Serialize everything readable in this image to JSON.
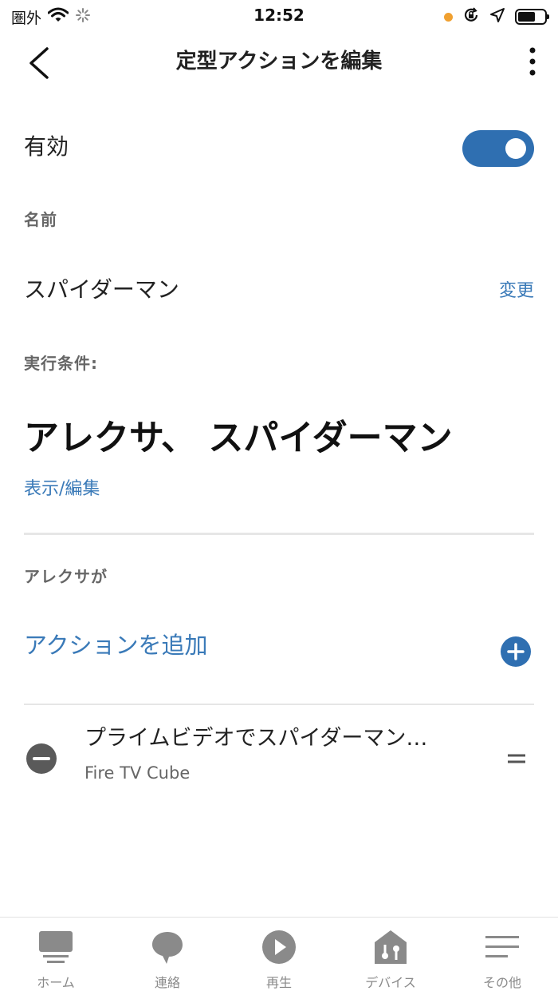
{
  "status_bar": {
    "carrier": "圏外",
    "time": "12:52",
    "battery_level": 0.65
  },
  "header": {
    "title": "定型アクションを編集",
    "back_icon": "chevron-left-icon",
    "more_icon": "more-vertical-icon"
  },
  "enabled": {
    "label": "有効",
    "value": true,
    "accent": "#2f6fb1"
  },
  "name_section": {
    "label": "名前",
    "value": "スパイダーマン",
    "change_link": "変更"
  },
  "trigger_section": {
    "label": "実行条件:",
    "phrase": "アレクサ、 スパイダーマン",
    "view_edit_link": "表示/編集"
  },
  "alexa_section": {
    "label": "アレクサが",
    "add_action": "アクションを追加",
    "actions": [
      {
        "title": "プライムビデオでスパイダーマン…",
        "device": "Fire TV Cube"
      }
    ]
  },
  "bottom_nav": [
    {
      "label": "ホーム",
      "icon": "home-card-icon"
    },
    {
      "label": "連絡",
      "icon": "chat-bubble-icon"
    },
    {
      "label": "再生",
      "icon": "play-icon"
    },
    {
      "label": "デバイス",
      "icon": "device-house-icon"
    },
    {
      "label": "その他",
      "icon": "menu-lines-icon"
    }
  ]
}
